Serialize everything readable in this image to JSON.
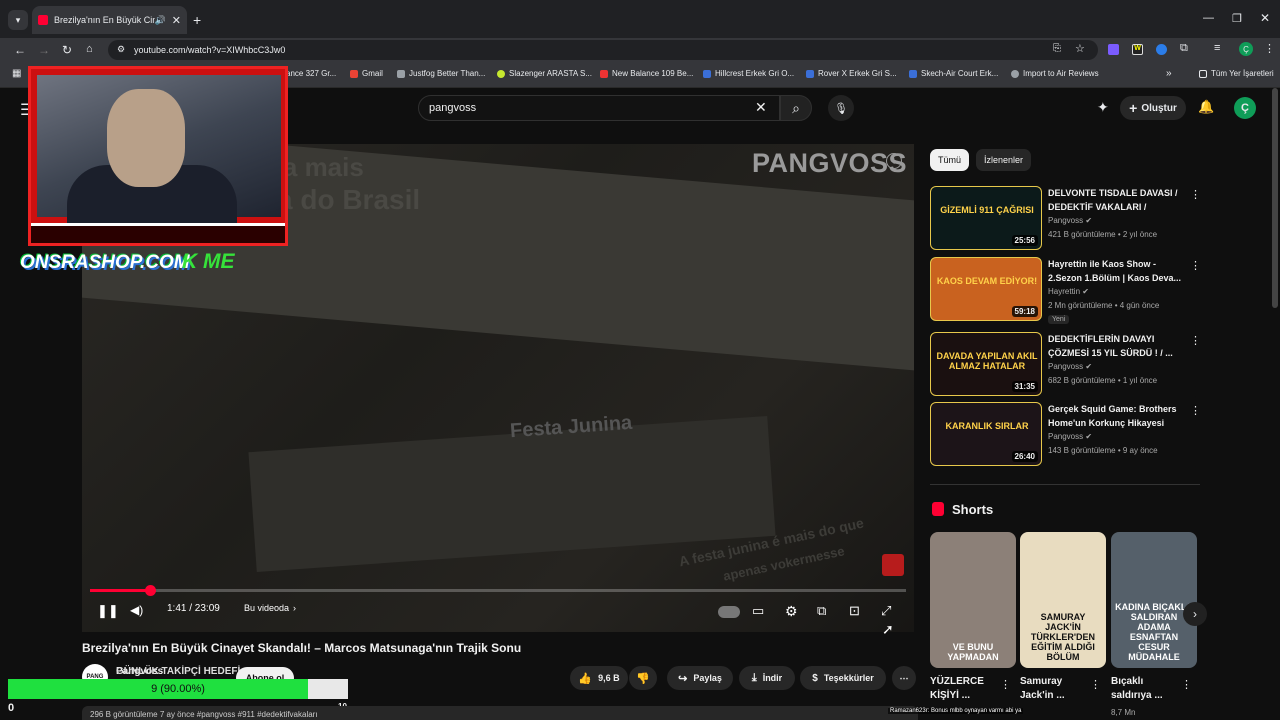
{
  "browser": {
    "tab_title": "Brezilya'nın En Büyük Cinay...",
    "url": "youtube.com/watch?v=XIWhbcC3Jw0",
    "bookmarks": [
      "ance 327 Gr...",
      "Gmail",
      "Justfog Better Than...",
      "Slazenger ARASTA S...",
      "New Balance 109 Be...",
      "Hillcrest Erkek Gri O...",
      "Rover X Erkek Gri S...",
      "Skech-Air Court Erk...",
      "Import to Air Reviews"
    ],
    "all_bookmarks": "Tüm Yer İşaretleri"
  },
  "youtube": {
    "search_value": "pangvoss",
    "create_label": "Oluştur",
    "avatar_letter": "Ç"
  },
  "overlay": {
    "shop_name": "ONSRASHOP.COM",
    "kick_label": "K ME",
    "goal_title": "GÜNLÜK TAKİPÇİ HEDEFİ",
    "goal_text": "9 (90.00%)",
    "goal_fraction": 0.9,
    "goal_min": "0",
    "goal_max": "10",
    "chat_line": "Ramazan623r: Bonus mlbb oynayan varmı abi ya"
  },
  "video": {
    "watermark": "PANGVOSS",
    "bg_text_1": "na mais",
    "bg_text_2": "a do Brasil",
    "bg_text_3": "Festa Junina",
    "bg_text_4": "A festa junina é mais do que",
    "bg_text_5": "apenas vokermesse",
    "time": "1:41 / 23:09",
    "in_this_video": "Bu videoda",
    "progress_fraction": 0.073
  },
  "title": "Brezilya'nın En Büyük Cinayet Skandalı! – Marcos Matsunaga'nın Trajik Sonu",
  "channel": {
    "name": "Pangvoss",
    "logo_text": "PANG",
    "subscribe": "Abone ol"
  },
  "actions": {
    "likes": "9,6 B",
    "share": "Paylaş",
    "download": "İndir",
    "thanks": "Teşekkürler"
  },
  "meta_line": "296 B görüntüleme  7 ay önce  #pangvoss #911 #dedektifvakaları",
  "chips": [
    "Tümü",
    "İzlenenler"
  ],
  "recommendations": [
    {
      "title": "DELVONTE TISDALE DAVASI / DEDEKTİF VAKALARI /",
      "channel": "Pangvoss",
      "meta": "421 B görüntüleme • 2 yıl önce",
      "duration": "25:56",
      "thumb_text": "GİZEMLİ 911 ÇAĞRISI",
      "thumb_color": "#0c1a1a"
    },
    {
      "title": "Hayrettin ile Kaos Show - 2.Sezon 1.Bölüm | Kaos Deva...",
      "channel": "Hayrettin",
      "meta": "2 Mn görüntüleme • 4 gün önce",
      "duration": "59:18",
      "thumb_text": "KAOS DEVAM EDİYOR!",
      "thumb_color": "#c9621f",
      "badge": "Yeni"
    },
    {
      "title": "DEDEKTİFLERİN DAVAYI ÇÖZMESİ 15 YIL SÜRDÜ ! / ...",
      "channel": "Pangvoss",
      "meta": "682 B görüntüleme • 1 yıl önce",
      "duration": "31:35",
      "thumb_text": "DAVADA YAPILAN AKIL ALMAZ HATALAR",
      "thumb_color": "#1a1010"
    },
    {
      "title": "Gerçek Squid Game: Brothers Home'un Korkunç Hikayesi",
      "channel": "Pangvoss",
      "meta": "143 B görüntüleme • 9 ay önce",
      "duration": "26:40",
      "thumb_text": "KARANLIK SIRLAR",
      "thumb_color": "#1c1418"
    }
  ],
  "shorts": {
    "heading": "Shorts",
    "items": [
      {
        "title": "YÜZLERCE KİŞİYİ ...",
        "caption": "VE BUNU YAPMADAN",
        "views": "",
        "color": "#8c8078"
      },
      {
        "title": "Samuray Jack'in ...",
        "caption": "SAMURAY JACK'İN TÜRKLER'DEN EĞİTİM ALDIĞI BÖLÜM",
        "views": "",
        "color": "#e8dcc0"
      },
      {
        "title": "Bıçaklı saldırıya ...",
        "caption": "KADINA BIÇAKLA SALDIRAN ADAMA ESNAFTAN CESUR MÜDAHALE",
        "views": "8,7 Mn",
        "color": "#55606a"
      }
    ]
  }
}
